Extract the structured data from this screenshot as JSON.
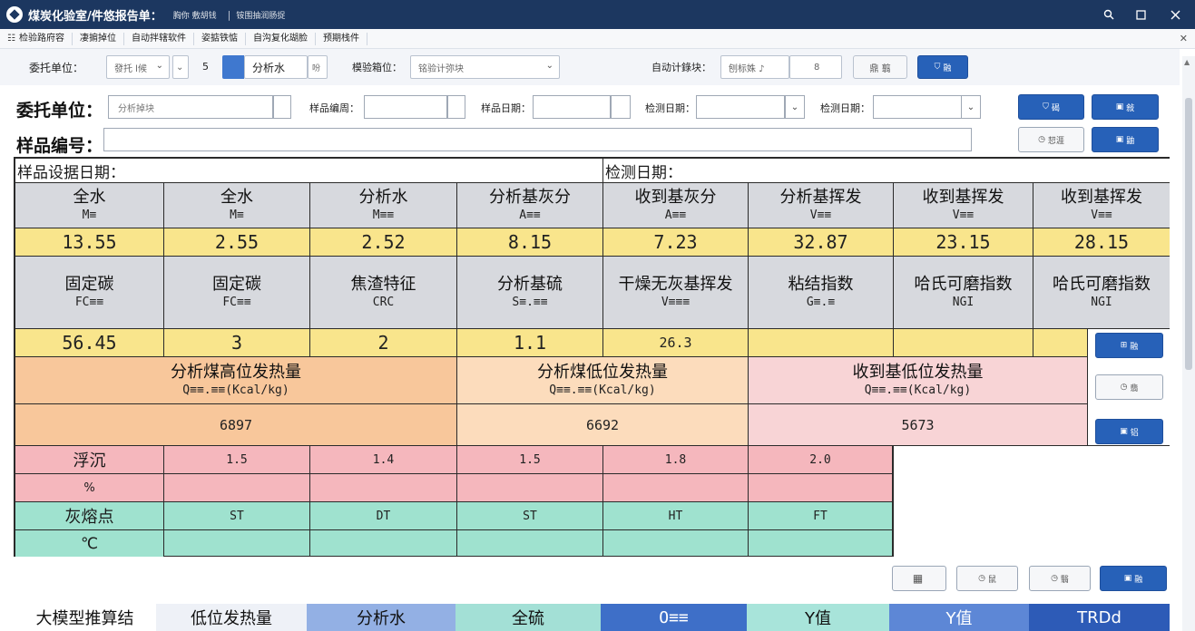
{
  "window": {
    "title": "煤炭化验室/件悠报告单：",
    "subtitle1": "胸你 敷胡钱",
    "subtitle2": "铵围抽润肠捉"
  },
  "menu": [
    "检验路府容",
    "凄掮掉位",
    "自动拌辖软件",
    "姿掂铁惦",
    "自沟复化瑚脸",
    "预期栈件"
  ],
  "toolbar": {
    "unit_label": "委托单位：",
    "unit_value": "發托 l候",
    "count": "5",
    "analysis_value": "分析水",
    "analysis_icon_text": "吩",
    "check_label": "模验箱位：",
    "check_value": "铭验计弥块",
    "auto_label": "自动计錄块：",
    "auto_value": "刨标姝 ♪",
    "auto_value2": "8",
    "btn_query": "鼎 翦",
    "btn_confirm": "融"
  },
  "form": {
    "unit_label": "委托单位：",
    "unit_placeholder": "分析掉块",
    "sample_no_label": "样品编周：",
    "sample_date_label": "样品日期：",
    "test_date_label1": "检测日期：",
    "test_date_label2": "检测日期：",
    "sample_number_label": "样品编号：",
    "btn_a": "碣",
    "btn_b": "敍",
    "btn_c": "恝涯",
    "btn_d": "鼬"
  },
  "table": {
    "sample_date_label": "样品设据日期：",
    "test_date_label": "检测日期：",
    "row1_headers": [
      {
        "cn": "全水",
        "sym": "M≡"
      },
      {
        "cn": "全水",
        "sym": "M≡"
      },
      {
        "cn": "分析水",
        "sym": "M≡≡"
      },
      {
        "cn": "分析基灰分",
        "sym": "A≡≡"
      },
      {
        "cn": "收到基灰分",
        "sym": "A≡≡"
      },
      {
        "cn": "分析基挥发",
        "sym": "V≡≡"
      },
      {
        "cn": "收到基挥发",
        "sym": "V≡≡"
      },
      {
        "cn": "收到基挥发",
        "sym": "V≡≡"
      }
    ],
    "row1_values": [
      "13.55",
      "2.55",
      "2.52",
      "8.15",
      "7.23",
      "32.87",
      "23.15",
      "28.15"
    ],
    "row2_headers": [
      {
        "cn": "固定碳",
        "sym": "FC≡≡"
      },
      {
        "cn": "固定碳",
        "sym": "FC≡≡"
      },
      {
        "cn": "焦渣特征",
        "sym": "CRC"
      },
      {
        "cn": "分析基硫",
        "sym": "S≡.≡≡"
      },
      {
        "cn": "干燥无灰基挥发",
        "sym": "V≡≡≡"
      },
      {
        "cn": "粘结指数",
        "sym": "G≡.≡"
      },
      {
        "cn": "哈氏可磨指数",
        "sym": "NGI"
      },
      {
        "cn": "哈氏可磨指数",
        "sym": "NGI"
      }
    ],
    "row2_values": [
      "56.45",
      "3",
      "2",
      "1.1",
      "26.3",
      "",
      "",
      ""
    ],
    "heat_headers": [
      {
        "cn": "分析煤高位发热量",
        "sym": "Q≡≡.≡≡(Kcal/kg)"
      },
      {
        "cn": "分析煤低位发热量",
        "sym": "Q≡≡.≡≡(Kcal/kg)"
      },
      {
        "cn": "收到基低位发热量",
        "sym": "Q≡≡.≡≡(Kcal/kg)"
      }
    ],
    "heat_values": [
      "6897",
      "6692",
      "5673"
    ],
    "side_btn1": "融",
    "side_btn2": "翡",
    "side_btn3": "铝",
    "float_label": "浮沉",
    "float_values": [
      "1.5",
      "1.4",
      "1.5",
      "1.8",
      "2.0"
    ],
    "percent_label": "%",
    "ash_label": "灰熔点",
    "ash_values": [
      "ST",
      "DT",
      "ST",
      "HT",
      "FT"
    ],
    "celsius_label": "℃"
  },
  "bottom_buttons": [
    "",
    "鼠",
    "翳",
    "融"
  ],
  "bottom_row": {
    "label": "大模型推算结",
    "cells": [
      "低位发热量",
      "分析水",
      "全硫",
      "O≡≡",
      "Y值",
      "Y值",
      "TRDd"
    ]
  },
  "colors": {
    "titlebar": "#1c3760",
    "accent": "#2761b8",
    "yellow": "#f9e58c",
    "orange": "#f8c79b",
    "pink": "#f5b7bd",
    "mint": "#9fe2cf"
  }
}
